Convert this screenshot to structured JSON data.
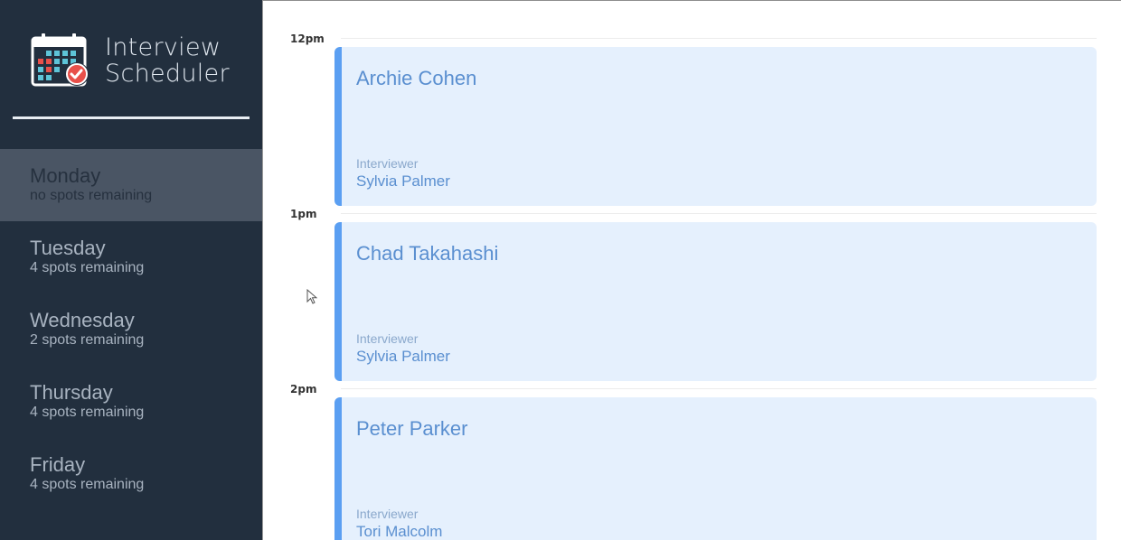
{
  "app": {
    "title_line1": "Interview",
    "title_line2": "Scheduler",
    "logo_icon": "calendar-check-icon"
  },
  "days": [
    {
      "name": "Monday",
      "spots": "no spots remaining",
      "selected": true
    },
    {
      "name": "Tuesday",
      "spots": "4 spots remaining",
      "selected": false
    },
    {
      "name": "Wednesday",
      "spots": "2 spots remaining",
      "selected": false
    },
    {
      "name": "Thursday",
      "spots": "4 spots remaining",
      "selected": false
    },
    {
      "name": "Friday",
      "spots": "4 spots remaining",
      "selected": false
    }
  ],
  "appointments": [
    {
      "time": "12pm",
      "student": "Archie Cohen",
      "interviewer_label": "Interviewer",
      "interviewer": "Sylvia Palmer"
    },
    {
      "time": "1pm",
      "student": "Chad Takahashi",
      "interviewer_label": "Interviewer",
      "interviewer": "Sylvia Palmer"
    },
    {
      "time": "2pm",
      "student": "Peter Parker",
      "interviewer_label": "Interviewer",
      "interviewer": "Tori Malcolm"
    }
  ],
  "colors": {
    "sidebar": "#222f3e",
    "selected_day": "#4a5564",
    "card_bg": "#e5f0fd",
    "card_accent": "#5b9ff2",
    "card_text": "#5a8fd0"
  }
}
